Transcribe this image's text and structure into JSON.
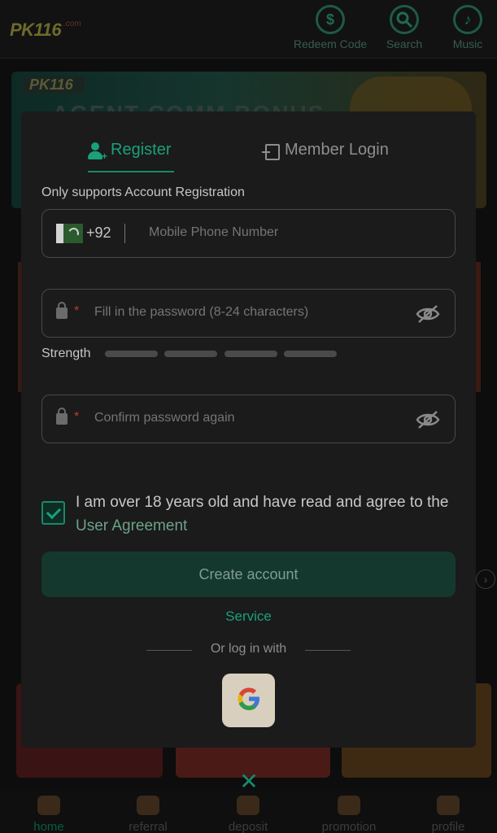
{
  "header": {
    "logo": "PK116",
    "logo_sub": ".com",
    "items": [
      {
        "label": "Redeem Code",
        "icon": "redeem-icon"
      },
      {
        "label": "Search",
        "icon": "search-icon"
      },
      {
        "label": "Music",
        "icon": "music-icon"
      }
    ]
  },
  "banner": {
    "logo": "PK116",
    "title": "AGENT COMM BONUS"
  },
  "bottom_nav": [
    {
      "label": "home",
      "icon": "home-icon"
    },
    {
      "label": "referral",
      "icon": "referral-icon"
    },
    {
      "label": "deposit",
      "icon": "deposit-icon"
    },
    {
      "label": "promotion",
      "icon": "promotion-icon"
    },
    {
      "label": "profile",
      "icon": "profile-icon"
    }
  ],
  "modal": {
    "tabs": {
      "register": "Register",
      "login": "Member Login"
    },
    "section_label": "Only supports Account Registration",
    "phone": {
      "country_code": "+92",
      "placeholder": "Mobile Phone Number"
    },
    "password": {
      "required_mark": "*",
      "placeholder": "Fill in the password (8-24 characters)"
    },
    "strength": {
      "label": "Strength",
      "level": 0,
      "bars": 4
    },
    "confirm": {
      "required_mark": "*",
      "placeholder": "Confirm password again"
    },
    "agree": {
      "text": "I am over 18 years old and have read and agree to the ",
      "link": "User Agreement",
      "checked": true
    },
    "create_button": "Create account",
    "service": "Service",
    "alt_login": "Or log in with",
    "google_icon": "google-icon",
    "close_icon": "close-icon"
  },
  "colors": {
    "accent": "#1aa07b",
    "modal_bg": "#1a1b1a",
    "page_bg": "#0c0d0c",
    "button_bg": "#15382e"
  }
}
